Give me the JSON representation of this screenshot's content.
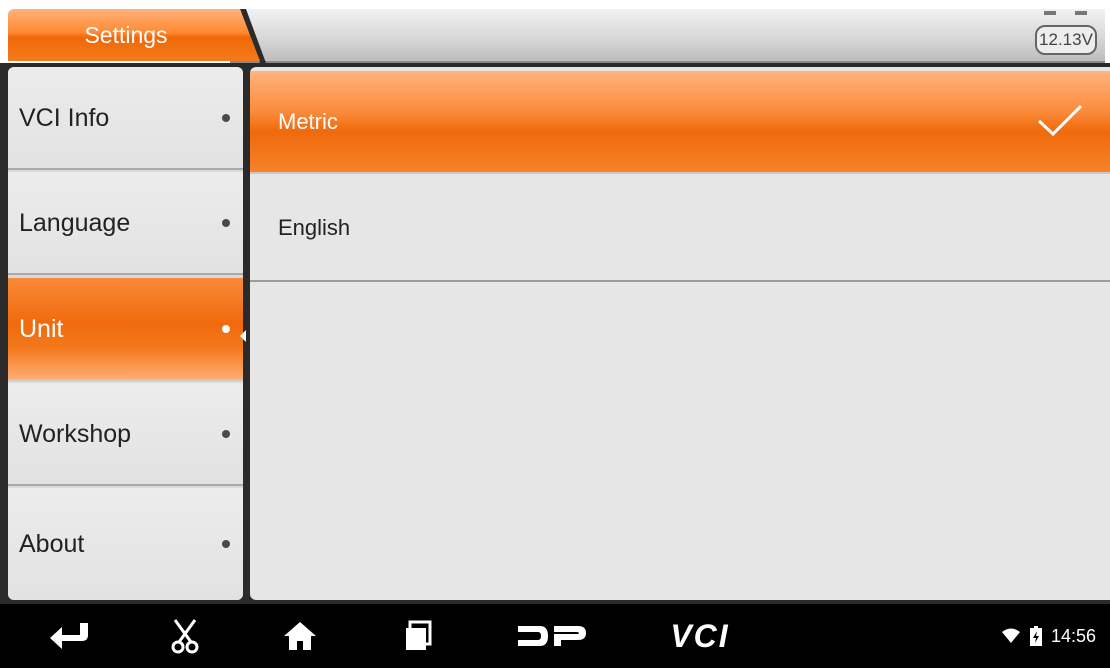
{
  "header": {
    "title": "Settings",
    "voltage": "12.13V"
  },
  "sidebar": {
    "items": [
      {
        "label": "VCI Info",
        "active": false
      },
      {
        "label": "Language",
        "active": false
      },
      {
        "label": "Unit",
        "active": true
      },
      {
        "label": "Workshop",
        "active": false
      },
      {
        "label": "About",
        "active": false
      }
    ]
  },
  "content": {
    "options": [
      {
        "label": "Metric",
        "selected": true
      },
      {
        "label": "English",
        "selected": false
      }
    ]
  },
  "navbar": {
    "icons": [
      "back-icon",
      "scissors-icon",
      "home-icon",
      "recent-apps-icon",
      "dp-logo-icon",
      "vci-icon"
    ],
    "vci_text": "VCI",
    "dp_text": "DP"
  },
  "status": {
    "time": "14:56",
    "icons": [
      "wifi-icon",
      "battery-charging-icon"
    ]
  },
  "colors": {
    "accent": "#f06a0c",
    "navbar": "#000000"
  }
}
